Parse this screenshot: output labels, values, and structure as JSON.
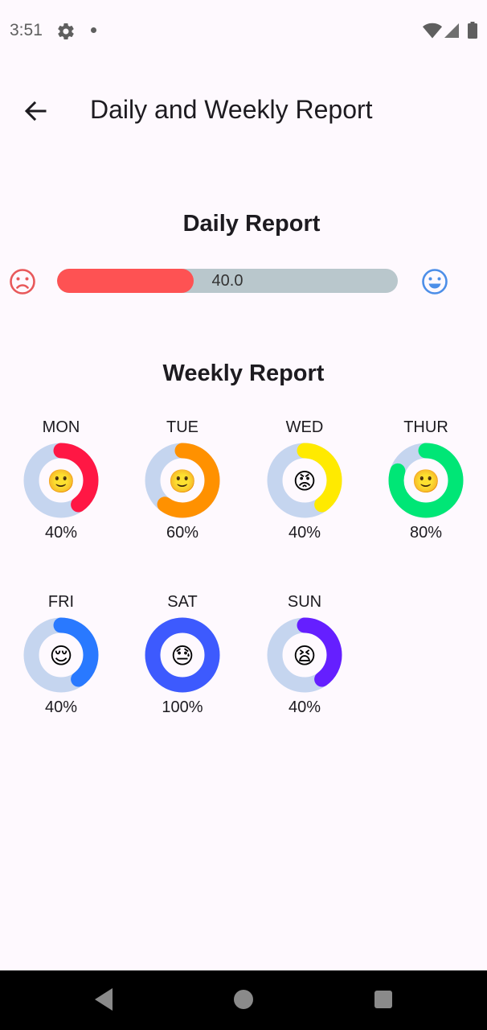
{
  "status_bar": {
    "time": "3:51",
    "icons": [
      "gear-icon",
      "notification-dot-icon",
      "wifi-icon",
      "signal-icon",
      "battery-icon"
    ]
  },
  "app_bar": {
    "title": "Daily and Weekly Report",
    "back_icon": "arrow-left-icon"
  },
  "daily": {
    "title": "Daily Report",
    "value_label": "40.0",
    "progress": 0.4,
    "left_icon": "sad-face-icon",
    "right_icon": "happy-face-icon",
    "colors": {
      "fill": "#FE5253",
      "track": "#B9C7CC",
      "sad": "#E8585A",
      "happy": "#4C8EE8"
    }
  },
  "weekly": {
    "title": "Weekly Report",
    "track_color": "#C5D5EF",
    "days": [
      {
        "label": "MON",
        "percent_label": "40%",
        "percent": 40,
        "color": "#FF1744",
        "emoji": "🙂"
      },
      {
        "label": "TUE",
        "percent_label": "60%",
        "percent": 60,
        "color": "#FF9100",
        "emoji": "🙂"
      },
      {
        "label": "WED",
        "percent_label": "40%",
        "percent": 40,
        "color": "#FFEA00",
        "emoji": "😡"
      },
      {
        "label": "THUR",
        "percent_label": "80%",
        "percent": 80,
        "color": "#00E676",
        "emoji": "🙂"
      },
      {
        "label": "FRI",
        "percent_label": "40%",
        "percent": 40,
        "color": "#2979FF",
        "emoji": "😌"
      },
      {
        "label": "SAT",
        "percent_label": "100%",
        "percent": 100,
        "color": "#3D5AFE",
        "emoji": "😓"
      },
      {
        "label": "SUN",
        "percent_label": "40%",
        "percent": 40,
        "color": "#651FFF",
        "emoji": "😫"
      }
    ]
  },
  "nav_bar": {
    "icons": [
      "nav-back-icon",
      "nav-home-icon",
      "nav-recents-icon"
    ]
  }
}
